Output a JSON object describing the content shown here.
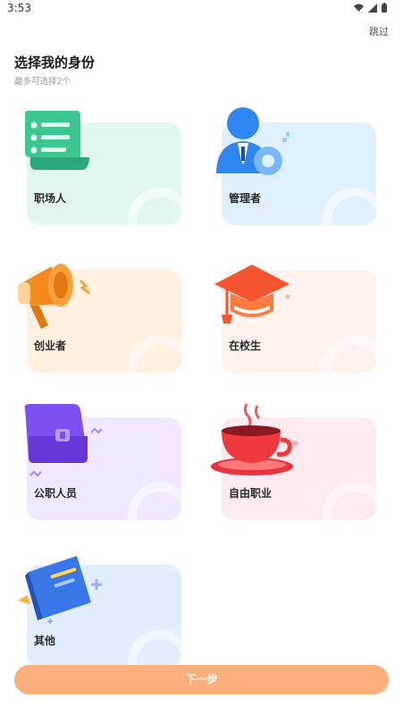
{
  "status_bar": {
    "time": "3:53"
  },
  "header": {
    "skip_label": "跳过",
    "title": "选择我的身份",
    "subtitle": "最多可选择2个"
  },
  "options": [
    {
      "label": "职场人",
      "icon": "scroll-checklist-icon",
      "bg": "#e3f7ee"
    },
    {
      "label": "管理者",
      "icon": "manager-gear-icon",
      "bg": "#e0f0fd"
    },
    {
      "label": "创业者",
      "icon": "megaphone-icon",
      "bg": "#fff0e0"
    },
    {
      "label": "在校生",
      "icon": "graduation-cap-icon",
      "bg": "#fff3ee"
    },
    {
      "label": "公职人员",
      "icon": "briefcase-icon",
      "bg": "#f1e8fd"
    },
    {
      "label": "自由职业",
      "icon": "coffee-cup-icon",
      "bg": "#fdebf0"
    },
    {
      "label": "其他",
      "icon": "book-icon",
      "bg": "#e3eefd"
    }
  ],
  "footer": {
    "next_label": "下一步"
  },
  "colors": {
    "accent": "#fbb07c"
  }
}
